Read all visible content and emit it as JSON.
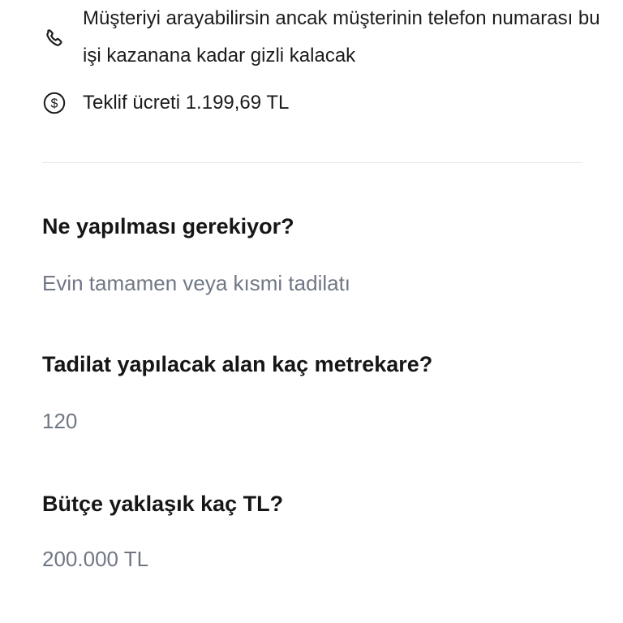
{
  "info": {
    "call_note": "Müşteriyi arayabilirsin ancak müşterinin telefon numarası bu işi kazanana kadar gizli kalacak",
    "fee_note": "Teklif ücreti 1.199,69 TL",
    "icons": {
      "call": "phone-icon",
      "fee": "dollar-coin-icon"
    }
  },
  "questions": [
    {
      "question": "Ne yapılması gerekiyor?",
      "answer": "Evin tamamen veya kısmi tadilatı"
    },
    {
      "question": "Tadilat yapılacak alan kaç metrekare?",
      "answer": "120"
    },
    {
      "question": "Bütçe yaklaşık kaç TL?",
      "answer": "200.000 TL"
    }
  ],
  "colors": {
    "text_primary": "#161616",
    "text_secondary": "#707784",
    "divider": "#e8e8ea"
  }
}
